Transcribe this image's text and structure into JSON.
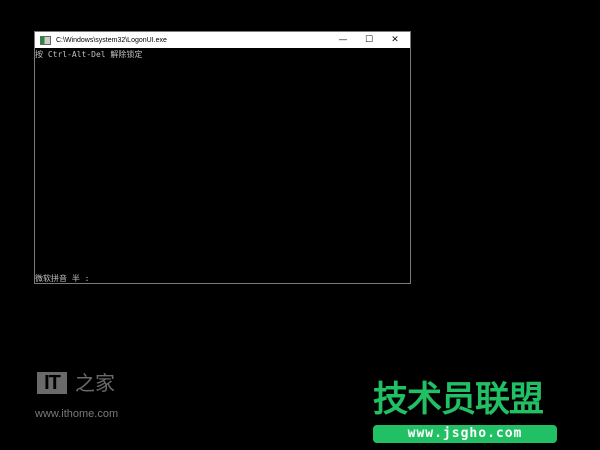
{
  "window": {
    "title": "C:\\Windows\\system32\\LogonUI.exe",
    "minimize": "—",
    "maximize": "☐",
    "close": "✕"
  },
  "console": {
    "line1": "按 Ctrl-Alt-Del 解除锁定",
    "ime_status": "微软拼音 半 :"
  },
  "watermarks": {
    "ithome_logo": "IT",
    "ithome_zhi": "之家",
    "ithome_site": "www.ithome.com",
    "jsgho_name": "技术员联盟",
    "jsgho_url": "www.jsgho.com"
  },
  "colors": {
    "accent_green": "#22c064",
    "console_text": "#c0c0c0"
  }
}
